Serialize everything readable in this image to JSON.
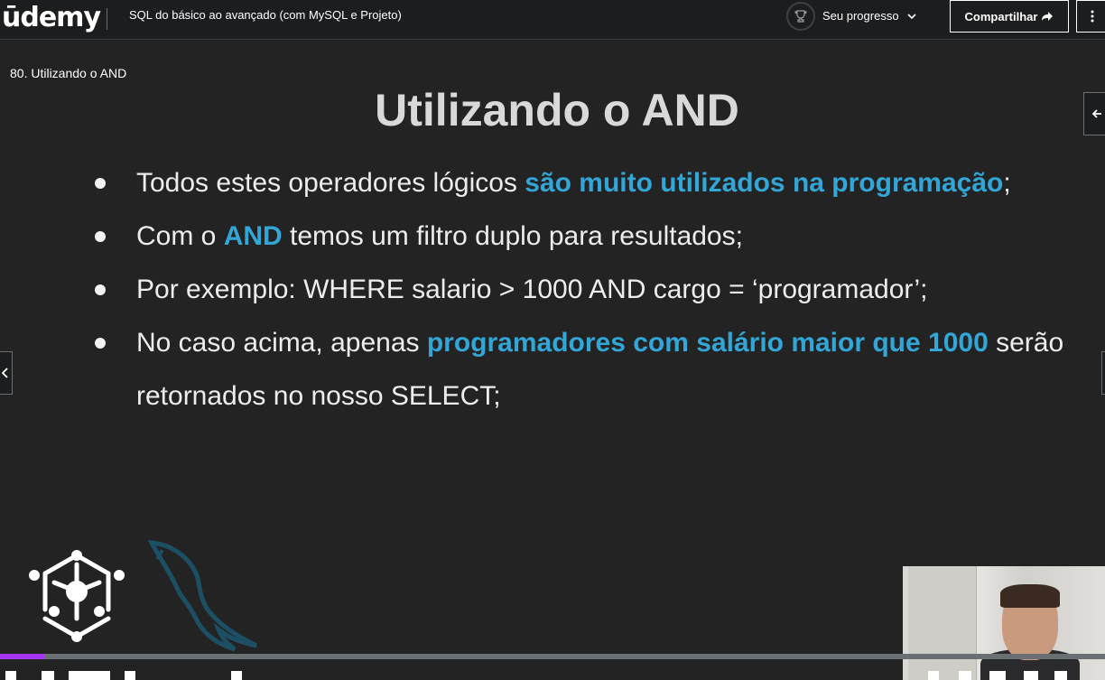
{
  "header": {
    "logo_text": "ūdemy",
    "course_title": "SQL do básico ao avançado (com MySQL e Projeto)",
    "progress_label": "Seu progresso",
    "share_label": "Compartilhar"
  },
  "video": {
    "lecture_title": "80. Utilizando o AND",
    "progress_fraction": 0.04,
    "slide": {
      "title": "Utilizando o AND",
      "bullets": [
        {
          "before": "Todos estes operadores lógicos ",
          "highlight": "são muito utilizados na programação",
          "after": ";"
        },
        {
          "before": "Com o ",
          "highlight": "AND",
          "after": " temos um filtro duplo para resultados;"
        },
        {
          "before": "Por exemplo: WHERE salario > 1000 AND cargo = ‘programador’;",
          "highlight": "",
          "after": ""
        },
        {
          "before": "No caso acima, apenas ",
          "highlight": "programadores com salário maior que 1000",
          "after": " serão retornados no nosso SELECT;"
        }
      ]
    }
  },
  "colors": {
    "accent": "#a435f0",
    "highlight": "#32a6d6",
    "background": "#1c1d1f"
  }
}
